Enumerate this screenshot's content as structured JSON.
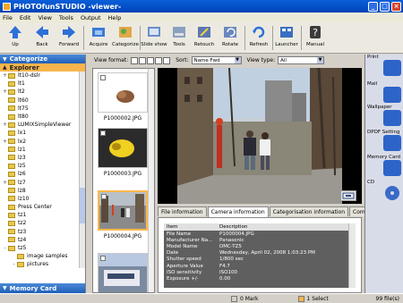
{
  "window": {
    "title": "PHOTOfunSTUDIO -viewer-"
  },
  "menu": [
    "File",
    "Edit",
    "View",
    "Tools",
    "Output",
    "Help"
  ],
  "toolbar": {
    "up": "Up",
    "back": "Back",
    "forward": "Forward",
    "acquire": "Acquire",
    "categorize": "Categorize",
    "slideshow": "Slide show",
    "tools": "Tools",
    "retouch": "Retouch",
    "rotate": "Rotate",
    "refresh": "Refresh",
    "launcher": "Launcher",
    "manual": "Manual"
  },
  "left": {
    "categorize": "Categorize",
    "explorer": "Explorer",
    "tree": [
      {
        "label": "lt10-dslr",
        "exp": "+"
      },
      {
        "label": "lt1",
        "exp": ""
      },
      {
        "label": "lt2",
        "exp": "+"
      },
      {
        "label": "lt60",
        "exp": ""
      },
      {
        "label": "lt75",
        "exp": ""
      },
      {
        "label": "lt80",
        "exp": ""
      },
      {
        "label": "LUMIXSimpleViewer",
        "exp": "+"
      },
      {
        "label": "lx1",
        "exp": ""
      },
      {
        "label": "lx2",
        "exp": "+"
      },
      {
        "label": "lz1",
        "exp": ""
      },
      {
        "label": "lz3",
        "exp": ""
      },
      {
        "label": "lz5",
        "exp": ""
      },
      {
        "label": "lz6",
        "exp": ""
      },
      {
        "label": "lz7",
        "exp": "+"
      },
      {
        "label": "lz8",
        "exp": ""
      },
      {
        "label": "lz10",
        "exp": ""
      },
      {
        "label": "Press Center",
        "exp": ""
      },
      {
        "label": "tz1",
        "exp": ""
      },
      {
        "label": "tz2",
        "exp": ""
      },
      {
        "label": "tz3",
        "exp": ""
      },
      {
        "label": "tz4",
        "exp": ""
      },
      {
        "label": "tz5",
        "exp": "-"
      },
      {
        "label": "image samples",
        "exp": ""
      },
      {
        "label": "pictures",
        "exp": "-"
      },
      {
        "label": "screens",
        "exp": ""
      }
    ],
    "memory_card": "Memory Card"
  },
  "viewbar": {
    "view_format_label": "View format:",
    "sort_label": "Sort:",
    "sort_value": "Name Fwd",
    "view_type_label": "View type:",
    "view_type_value": "All"
  },
  "thumbnails": [
    {
      "filename": "P1000002.JPG"
    },
    {
      "filename": "P1000003.JPG"
    },
    {
      "filename": "P1000004.JPG"
    }
  ],
  "info_tabs": [
    "File information",
    "Camera information",
    "Categorisation information",
    "Comment"
  ],
  "info": {
    "header_item": "Item",
    "header_desc": "Description",
    "rows": [
      {
        "item": "File Name",
        "desc": "P1000004.JPG"
      },
      {
        "item": "Manufacturer Na...",
        "desc": "Panasonic"
      },
      {
        "item": "Model Name",
        "desc": "DMC-TZ5"
      },
      {
        "item": "Date",
        "desc": "Wednesday, April 02, 2008 1:03:23 PM"
      },
      {
        "item": "Shutter speed",
        "desc": "1/800 sec"
      },
      {
        "item": "Aperture Value",
        "desc": "F4.7"
      },
      {
        "item": "ISO sensitivity",
        "desc": "ISO100"
      },
      {
        "item": "Exposure +/-",
        "desc": "0.00"
      }
    ]
  },
  "right_panel": [
    {
      "label": "Print"
    },
    {
      "label": "Mail"
    },
    {
      "label": "Wallpaper"
    },
    {
      "label": "DPOF Setting"
    },
    {
      "label": "Memory Card"
    },
    {
      "label": "CD"
    }
  ],
  "status": {
    "mark": "0 Mark",
    "select": "1 Select",
    "files": "99 file(s)"
  },
  "colors": {
    "title_bar": "#0a5fd8",
    "category_header": "#1f5fb8",
    "explorer_header": "#f7b44b",
    "selection": "#ffb84a"
  }
}
